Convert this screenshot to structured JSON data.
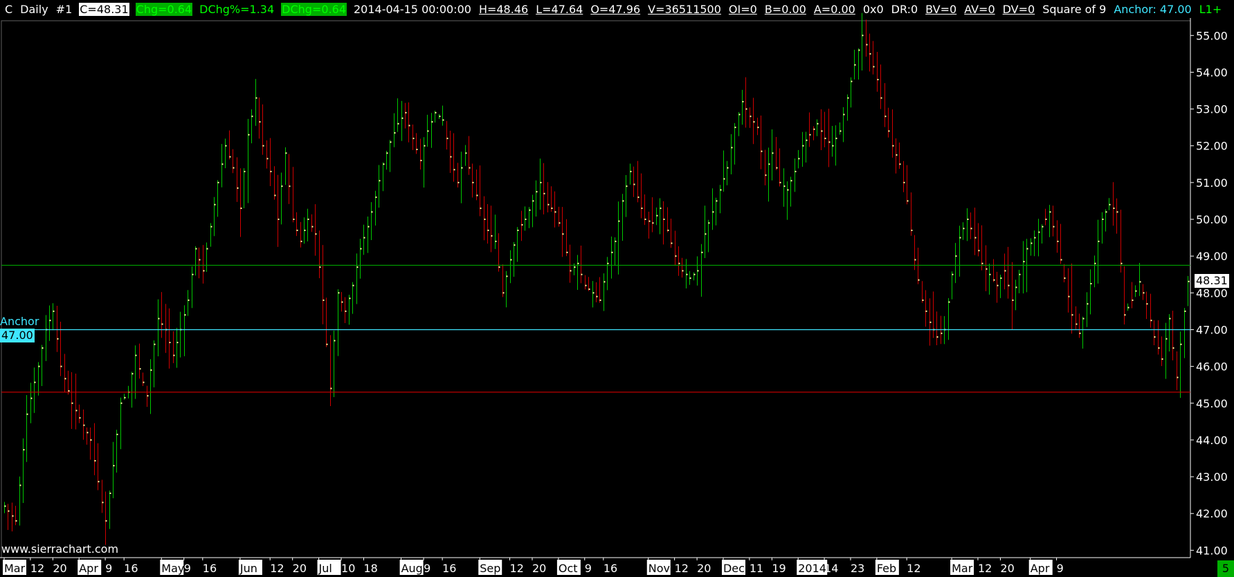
{
  "header": {
    "symbol": "C",
    "period": "Daily",
    "chart_number": "#1",
    "close": "C=48.31",
    "chg": "Chg=0.64",
    "dchg_pct": "DChg%=1.34",
    "dchg": "DChg=0.64",
    "datetime": "2014-04-15 00:00:00",
    "high": "H=48.46",
    "low": "L=47.64",
    "open": "O=47.96",
    "volume": "V=36511500",
    "oi": "OI=0",
    "bid": "B=0.00",
    "ask": "A=0.00",
    "hex": "0x0",
    "dr": "DR:0",
    "bv": "BV=0",
    "av": "AV=0",
    "dv": "DV=0",
    "study": "Square of 9",
    "anchor": "Anchor: 47.00",
    "l1": "L1+"
  },
  "watermark": "www.sierrachart.com",
  "anchor_label": "Anchor",
  "anchor_value": "47.00",
  "last_price_label": "48.31",
  "corner_label": "5",
  "colors": {
    "up": "#00c800",
    "down": "#d00000",
    "close_tick": "#ffffa0",
    "grid_line": "#00a000",
    "anchor_line": "#3fe6ff",
    "support_line": "#d00000",
    "axis_text": "#ffffff"
  },
  "chart_data": {
    "type": "ohlc",
    "title": "",
    "xlabel": "",
    "ylabel": "",
    "ylim": [
      40.8,
      55.4
    ],
    "y_ticks": [
      "41.00",
      "42.00",
      "43.00",
      "44.00",
      "45.00",
      "46.00",
      "47.00",
      "48.00",
      "49.00",
      "50.00",
      "51.00",
      "52.00",
      "53.00",
      "54.00",
      "55.00"
    ],
    "x_tick_labels": [
      {
        "label": "Mar",
        "index": 0,
        "month": true
      },
      {
        "label": "12",
        "index": 7
      },
      {
        "label": "20",
        "index": 13
      },
      {
        "label": "Apr",
        "index": 20,
        "month": true
      },
      {
        "label": "9",
        "index": 27
      },
      {
        "label": "16",
        "index": 32
      },
      {
        "label": "May",
        "index": 42,
        "month": true
      },
      {
        "label": "9",
        "index": 48
      },
      {
        "label": "16",
        "index": 53
      },
      {
        "label": "Jun",
        "index": 63,
        "month": true
      },
      {
        "label": "12",
        "index": 71
      },
      {
        "label": "20",
        "index": 77
      },
      {
        "label": "Jul",
        "index": 84,
        "month": true
      },
      {
        "label": "10",
        "index": 90
      },
      {
        "label": "18",
        "index": 96
      },
      {
        "label": "Aug",
        "index": 106,
        "month": true
      },
      {
        "label": "9",
        "index": 112
      },
      {
        "label": "16",
        "index": 117
      },
      {
        "label": "Sep",
        "index": 127,
        "month": true
      },
      {
        "label": "12",
        "index": 135
      },
      {
        "label": "20",
        "index": 141
      },
      {
        "label": "Oct",
        "index": 148,
        "month": true
      },
      {
        "label": "9",
        "index": 155
      },
      {
        "label": "16",
        "index": 160
      },
      {
        "label": "Nov",
        "index": 172,
        "month": true
      },
      {
        "label": "12",
        "index": 179
      },
      {
        "label": "20",
        "index": 185
      },
      {
        "label": "Dec",
        "index": 192,
        "month": true
      },
      {
        "label": "11",
        "index": 199
      },
      {
        "label": "19",
        "index": 205
      },
      {
        "label": "2014",
        "index": 212,
        "month": true
      },
      {
        "label": "14",
        "index": 219
      },
      {
        "label": "23",
        "index": 226
      },
      {
        "label": "Feb",
        "index": 233,
        "month": true
      },
      {
        "label": "12",
        "index": 241
      },
      {
        "label": "Mar",
        "index": 253,
        "month": true
      },
      {
        "label": "12",
        "index": 260
      },
      {
        "label": "20",
        "index": 266
      },
      {
        "label": "Apr",
        "index": 274,
        "month": true
      },
      {
        "label": "9",
        "index": 281
      }
    ],
    "horizontal_lines": [
      {
        "name": "green-line",
        "value": 48.75,
        "color": "#00a000"
      },
      {
        "name": "anchor-line",
        "value": 47.0,
        "color": "#3fe6ff"
      },
      {
        "name": "support-line",
        "value": 45.3,
        "color": "#d00000"
      }
    ],
    "close_keypoints": [
      [
        0,
        42.2
      ],
      [
        3,
        41.8
      ],
      [
        6,
        44.7
      ],
      [
        9,
        46.0
      ],
      [
        11,
        47.0
      ],
      [
        13,
        47.5
      ],
      [
        15,
        46.0
      ],
      [
        18,
        45.0
      ],
      [
        20,
        44.6
      ],
      [
        23,
        44.0
      ],
      [
        26,
        42.3
      ],
      [
        27,
        41.8
      ],
      [
        29,
        43.3
      ],
      [
        31,
        45.0
      ],
      [
        33,
        45.3
      ],
      [
        35,
        46.3
      ],
      [
        38,
        45.2
      ],
      [
        41,
        47.3
      ],
      [
        43,
        47.0
      ],
      [
        45,
        46.3
      ],
      [
        47,
        47.0
      ],
      [
        49,
        47.8
      ],
      [
        51,
        49.2
      ],
      [
        53,
        48.6
      ],
      [
        55,
        49.8
      ],
      [
        57,
        51.0
      ],
      [
        59,
        52.0
      ],
      [
        61,
        51.4
      ],
      [
        63,
        50.3
      ],
      [
        65,
        52.3
      ],
      [
        67,
        53.3
      ],
      [
        69,
        52.0
      ],
      [
        71,
        51.3
      ],
      [
        73,
        50.0
      ],
      [
        75,
        51.8
      ],
      [
        77,
        50.0
      ],
      [
        79,
        49.4
      ],
      [
        81,
        50.0
      ],
      [
        83,
        49.6
      ],
      [
        85,
        47.8
      ],
      [
        87,
        45.4
      ],
      [
        89,
        48.0
      ],
      [
        91,
        47.5
      ],
      [
        93,
        48.2
      ],
      [
        95,
        49.2
      ],
      [
        97,
        49.8
      ],
      [
        99,
        50.6
      ],
      [
        101,
        51.5
      ],
      [
        103,
        52.1
      ],
      [
        105,
        52.6
      ],
      [
        107,
        52.9
      ],
      [
        109,
        52.2
      ],
      [
        111,
        51.6
      ],
      [
        113,
        52.4
      ],
      [
        115,
        52.9
      ],
      [
        117,
        52.7
      ],
      [
        119,
        51.7
      ],
      [
        121,
        51.0
      ],
      [
        123,
        51.8
      ],
      [
        125,
        51.0
      ],
      [
        127,
        50.3
      ],
      [
        129,
        49.7
      ],
      [
        131,
        49.4
      ],
      [
        133,
        48.0
      ],
      [
        135,
        48.9
      ],
      [
        137,
        49.7
      ],
      [
        139,
        50.0
      ],
      [
        141,
        50.5
      ],
      [
        143,
        51.0
      ],
      [
        145,
        50.4
      ],
      [
        147,
        50.2
      ],
      [
        149,
        49.6
      ],
      [
        151,
        48.6
      ],
      [
        153,
        48.8
      ],
      [
        155,
        48.2
      ],
      [
        157,
        48.0
      ],
      [
        159,
        47.8
      ],
      [
        161,
        48.8
      ],
      [
        163,
        49.4
      ],
      [
        165,
        50.5
      ],
      [
        167,
        51.3
      ],
      [
        169,
        50.6
      ],
      [
        171,
        50.0
      ],
      [
        173,
        49.9
      ],
      [
        175,
        50.3
      ],
      [
        177,
        49.7
      ],
      [
        179,
        49.0
      ],
      [
        181,
        48.6
      ],
      [
        183,
        48.4
      ],
      [
        185,
        48.6
      ],
      [
        187,
        49.6
      ],
      [
        189,
        50.2
      ],
      [
        191,
        50.8
      ],
      [
        193,
        51.4
      ],
      [
        195,
        52.5
      ],
      [
        197,
        53.2
      ],
      [
        199,
        52.8
      ],
      [
        201,
        52.5
      ],
      [
        203,
        51.2
      ],
      [
        205,
        51.8
      ],
      [
        207,
        51.0
      ],
      [
        209,
        50.8
      ],
      [
        211,
        51.3
      ],
      [
        213,
        52.0
      ],
      [
        215,
        52.3
      ],
      [
        217,
        52.6
      ],
      [
        219,
        52.2
      ],
      [
        221,
        52.0
      ],
      [
        223,
        52.4
      ],
      [
        225,
        53.3
      ],
      [
        227,
        54.2
      ],
      [
        229,
        55.0
      ],
      [
        231,
        54.5
      ],
      [
        233,
        53.8
      ],
      [
        235,
        52.8
      ],
      [
        237,
        52.0
      ],
      [
        239,
        51.5
      ],
      [
        241,
        50.5
      ],
      [
        243,
        48.9
      ],
      [
        245,
        47.8
      ],
      [
        247,
        47.2
      ],
      [
        249,
        46.8
      ],
      [
        251,
        47.0
      ],
      [
        253,
        48.5
      ],
      [
        255,
        49.5
      ],
      [
        257,
        50.0
      ],
      [
        259,
        49.5
      ],
      [
        261,
        48.8
      ],
      [
        263,
        48.5
      ],
      [
        265,
        48.2
      ],
      [
        267,
        48.6
      ],
      [
        269,
        47.8
      ],
      [
        271,
        48.5
      ],
      [
        273,
        49.2
      ],
      [
        275,
        49.5
      ],
      [
        277,
        49.8
      ],
      [
        279,
        50.2
      ],
      [
        281,
        49.4
      ],
      [
        283,
        48.4
      ],
      [
        285,
        47.4
      ],
      [
        287,
        46.9
      ],
      [
        289,
        47.7
      ],
      [
        291,
        48.8
      ],
      [
        293,
        50.0
      ],
      [
        295,
        50.4
      ],
      [
        297,
        50.2
      ],
      [
        299,
        47.4
      ],
      [
        301,
        47.8
      ],
      [
        303,
        48.3
      ],
      [
        305,
        47.7
      ],
      [
        307,
        46.8
      ],
      [
        309,
        46.2
      ],
      [
        311,
        47.3
      ],
      [
        313,
        45.7
      ],
      [
        315,
        47.5
      ],
      [
        316,
        48.31
      ]
    ],
    "last_bar": {
      "open": 47.96,
      "high": 48.46,
      "low": 47.64,
      "close": 48.31
    }
  }
}
